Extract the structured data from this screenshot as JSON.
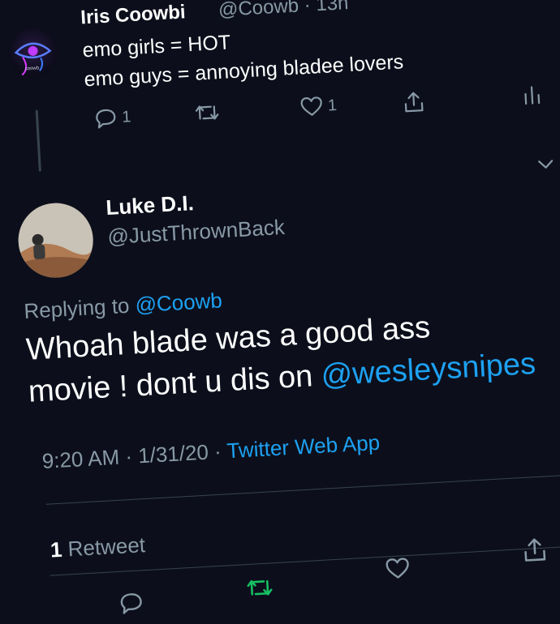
{
  "parent": {
    "name": "Iris Coowbi",
    "handle": "@Coowb",
    "sep": "·",
    "time": "13h",
    "line1": "emo girls = HOT",
    "line2": "emo guys = annoying bladee lovers",
    "avatar_text": "coowb",
    "actions": {
      "reply_count": "1",
      "retweet_count": "",
      "like_count": "1"
    }
  },
  "tweet": {
    "name": "Luke D.I.",
    "handle": "@JustThrownBack",
    "replying_prefix": "Replying to",
    "replying_to": "@Coowb",
    "text_line1": "Whoah blade was a good ass",
    "text_line2": "movie ! dont u dis on",
    "mention": "@wesleysnipes",
    "time": "9:20 AM",
    "date": "1/31/20",
    "sep": "·",
    "source": "Twitter Web App",
    "retweet_count": "1",
    "retweet_label": "Retweet"
  },
  "colors": {
    "background": "#0c0f1b",
    "link": "#1da1f2",
    "muted": "#8899a6",
    "retweet_active": "#17bf63"
  }
}
